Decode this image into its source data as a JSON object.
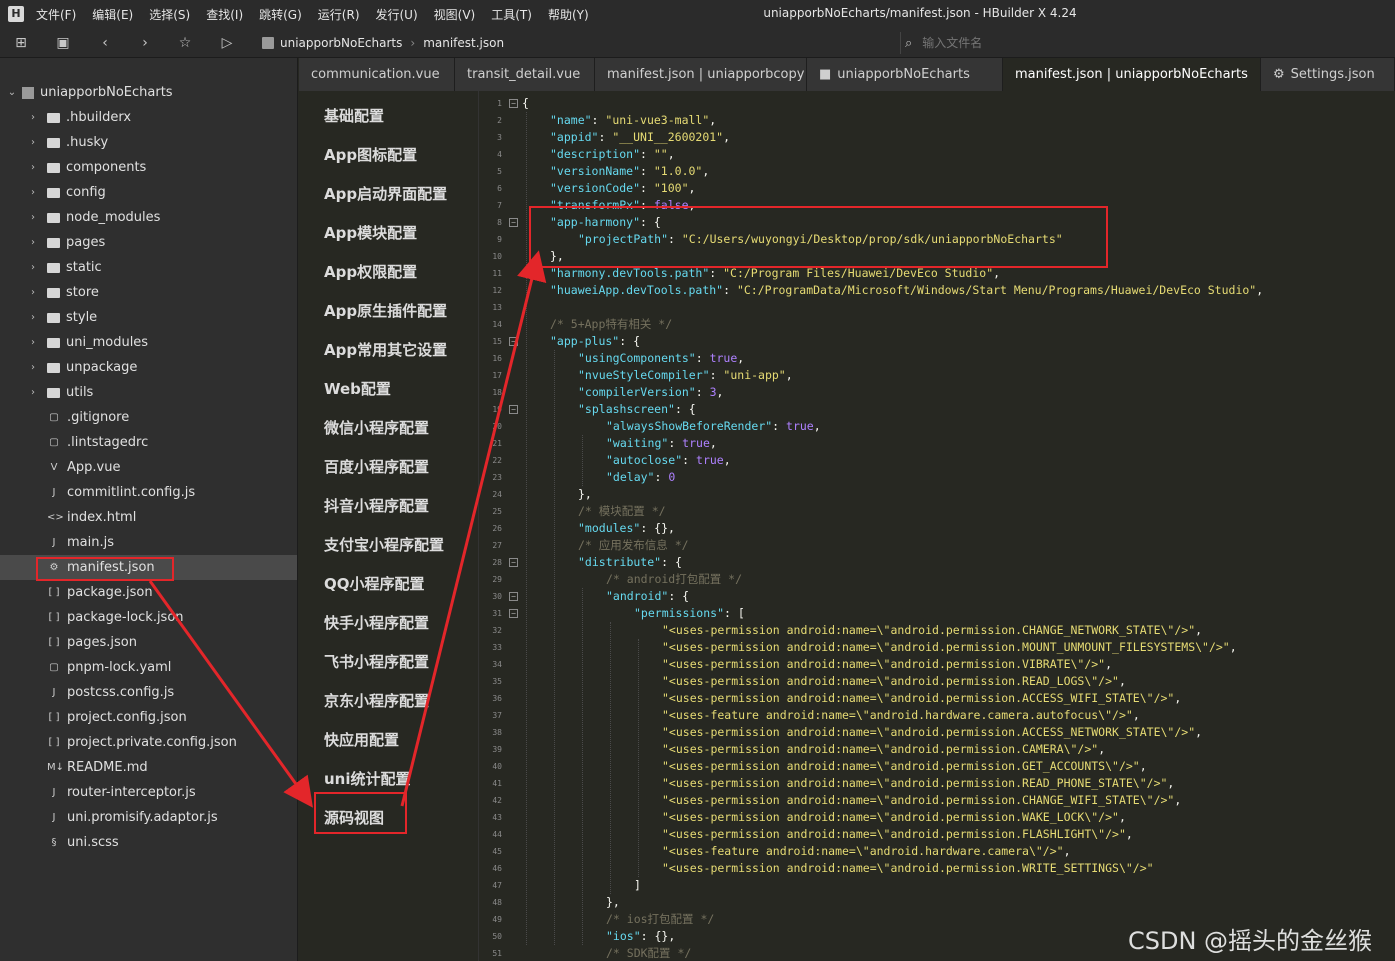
{
  "window": {
    "title": "uniapporbNoEcharts/manifest.json - HBuilder X 4.24"
  },
  "menu": [
    "文件(F)",
    "编辑(E)",
    "选择(S)",
    "查找(I)",
    "跳转(G)",
    "运行(R)",
    "发行(U)",
    "视图(V)",
    "工具(T)",
    "帮助(Y)"
  ],
  "toolbar": {
    "breadcrumb": [
      "uniapporbNoEcharts",
      "manifest.json"
    ],
    "search_placeholder": "输入文件名"
  },
  "sidebar": {
    "root": "uniapporbNoEcharts",
    "items": [
      {
        "label": ".hbuilderx",
        "type": "folder"
      },
      {
        "label": ".husky",
        "type": "folder"
      },
      {
        "label": "components",
        "type": "folder"
      },
      {
        "label": "config",
        "type": "folder"
      },
      {
        "label": "node_modules",
        "type": "folder"
      },
      {
        "label": "pages",
        "type": "folder"
      },
      {
        "label": "static",
        "type": "folder"
      },
      {
        "label": "store",
        "type": "folder"
      },
      {
        "label": "style",
        "type": "folder"
      },
      {
        "label": "uni_modules",
        "type": "folder"
      },
      {
        "label": "unpackage",
        "type": "folder"
      },
      {
        "label": "utils",
        "type": "folder"
      },
      {
        "label": ".gitignore",
        "type": "file"
      },
      {
        "label": ".lintstagedrc",
        "type": "file"
      },
      {
        "label": "App.vue",
        "type": "vue"
      },
      {
        "label": "commitlint.config.js",
        "type": "js"
      },
      {
        "label": "index.html",
        "type": "html"
      },
      {
        "label": "main.js",
        "type": "js"
      },
      {
        "label": "manifest.json",
        "type": "manifest",
        "selected": true
      },
      {
        "label": "package.json",
        "type": "json"
      },
      {
        "label": "package-lock.json",
        "type": "json"
      },
      {
        "label": "pages.json",
        "type": "json"
      },
      {
        "label": "pnpm-lock.yaml",
        "type": "file"
      },
      {
        "label": "postcss.config.js",
        "type": "js"
      },
      {
        "label": "project.config.json",
        "type": "json"
      },
      {
        "label": "project.private.config.json",
        "type": "json"
      },
      {
        "label": "README.md",
        "type": "md"
      },
      {
        "label": "router-interceptor.js",
        "type": "js"
      },
      {
        "label": "uni.promisify.adaptor.js",
        "type": "js"
      },
      {
        "label": "uni.scss",
        "type": "scss"
      }
    ]
  },
  "tabs": [
    {
      "label": "communication.vue",
      "active": false
    },
    {
      "label": "transit_detail.vue",
      "active": false
    },
    {
      "label": "manifest.json | uniapporbcopy",
      "active": false
    },
    {
      "label": "uniapporbNoEcharts",
      "active": false,
      "icon": "folder"
    },
    {
      "label": "manifest.json | uniapporbNoEcharts",
      "active": true
    },
    {
      "label": "Settings.json",
      "active": false,
      "icon": "gear"
    }
  ],
  "config_nav": [
    "基础配置",
    "App图标配置",
    "App启动界面配置",
    "App模块配置",
    "App权限配置",
    "App原生插件配置",
    "App常用其它设置",
    "Web配置",
    "微信小程序配置",
    "百度小程序配置",
    "抖音小程序配置",
    "支付宝小程序配置",
    "QQ小程序配置",
    "快手小程序配置",
    "飞书小程序配置",
    "京东小程序配置",
    "快应用配置",
    "uni统计配置",
    "源码视图"
  ],
  "code": {
    "lines": [
      {
        "n": "1",
        "fold": true,
        "indent": 0,
        "parts": [
          [
            "p",
            "{"
          ]
        ]
      },
      {
        "n": "2",
        "indent": 1,
        "parts": [
          [
            "k",
            "\"name\""
          ],
          [
            "p",
            ": "
          ],
          [
            "s",
            "\"uni-vue3-mall\""
          ],
          [
            "p",
            ","
          ]
        ]
      },
      {
        "n": "3",
        "indent": 1,
        "parts": [
          [
            "k",
            "\"appid\""
          ],
          [
            "p",
            ": "
          ],
          [
            "s",
            "\"__UNI__2600201\""
          ],
          [
            "p",
            ","
          ]
        ]
      },
      {
        "n": "4",
        "indent": 1,
        "parts": [
          [
            "k",
            "\"description\""
          ],
          [
            "p",
            ": "
          ],
          [
            "s",
            "\"\""
          ],
          [
            "p",
            ","
          ]
        ]
      },
      {
        "n": "5",
        "indent": 1,
        "parts": [
          [
            "k",
            "\"versionName\""
          ],
          [
            "p",
            ": "
          ],
          [
            "s",
            "\"1.0.0\""
          ],
          [
            "p",
            ","
          ]
        ]
      },
      {
        "n": "6",
        "indent": 1,
        "parts": [
          [
            "k",
            "\"versionCode\""
          ],
          [
            "p",
            ": "
          ],
          [
            "s",
            "\"100\""
          ],
          [
            "p",
            ","
          ]
        ]
      },
      {
        "n": "7",
        "indent": 1,
        "parts": [
          [
            "k",
            "\"transformPx\""
          ],
          [
            "p",
            ": "
          ],
          [
            "n",
            "false"
          ],
          [
            "p",
            ","
          ]
        ]
      },
      {
        "n": "8",
        "fold": true,
        "indent": 1,
        "parts": [
          [
            "k",
            "\"app-harmony\""
          ],
          [
            "p",
            ": {"
          ]
        ]
      },
      {
        "n": "9",
        "indent": 2,
        "parts": [
          [
            "k",
            "\"projectPath\""
          ],
          [
            "p",
            ": "
          ],
          [
            "s",
            "\"C:/Users/wuyongyi/Desktop/prop/sdk/uniapporbNoEcharts\""
          ]
        ]
      },
      {
        "n": "10",
        "indent": 1,
        "parts": [
          [
            "p",
            "},"
          ]
        ]
      },
      {
        "n": "11",
        "indent": 1,
        "parts": [
          [
            "k",
            "\"harmony.devTools.path\""
          ],
          [
            "p",
            ": "
          ],
          [
            "s",
            "\"C:/Program Files/Huawei/DevEco Studio\""
          ],
          [
            "p",
            ","
          ]
        ]
      },
      {
        "n": "12",
        "indent": 1,
        "parts": [
          [
            "k",
            "\"huaweiApp.devTools.path\""
          ],
          [
            "p",
            ": "
          ],
          [
            "s",
            "\"C:/ProgramData/Microsoft/Windows/Start Menu/Programs/Huawei/DevEco Studio\""
          ],
          [
            "p",
            ","
          ]
        ]
      },
      {
        "n": "13",
        "indent": 0,
        "parts": []
      },
      {
        "n": "14",
        "indent": 1,
        "parts": [
          [
            "c",
            "/* 5+App特有相关 */"
          ]
        ]
      },
      {
        "n": "15",
        "fold": true,
        "indent": 1,
        "parts": [
          [
            "k",
            "\"app-plus\""
          ],
          [
            "p",
            ": {"
          ]
        ]
      },
      {
        "n": "16",
        "indent": 2,
        "parts": [
          [
            "k",
            "\"usingComponents\""
          ],
          [
            "p",
            ": "
          ],
          [
            "n",
            "true"
          ],
          [
            "p",
            ","
          ]
        ]
      },
      {
        "n": "17",
        "indent": 2,
        "parts": [
          [
            "k",
            "\"nvueStyleCompiler\""
          ],
          [
            "p",
            ": "
          ],
          [
            "s",
            "\"uni-app\""
          ],
          [
            "p",
            ","
          ]
        ]
      },
      {
        "n": "18",
        "indent": 2,
        "parts": [
          [
            "k",
            "\"compilerVersion\""
          ],
          [
            "p",
            ": "
          ],
          [
            "n",
            "3"
          ],
          [
            "p",
            ","
          ]
        ]
      },
      {
        "n": "19",
        "fold": true,
        "indent": 2,
        "parts": [
          [
            "k",
            "\"splashscreen\""
          ],
          [
            "p",
            ": {"
          ]
        ]
      },
      {
        "n": "20",
        "indent": 3,
        "parts": [
          [
            "k",
            "\"alwaysShowBeforeRender\""
          ],
          [
            "p",
            ": "
          ],
          [
            "n",
            "true"
          ],
          [
            "p",
            ","
          ]
        ]
      },
      {
        "n": "21",
        "indent": 3,
        "parts": [
          [
            "k",
            "\"waiting\""
          ],
          [
            "p",
            ": "
          ],
          [
            "n",
            "true"
          ],
          [
            "p",
            ","
          ]
        ]
      },
      {
        "n": "22",
        "indent": 3,
        "parts": [
          [
            "k",
            "\"autoclose\""
          ],
          [
            "p",
            ": "
          ],
          [
            "n",
            "true"
          ],
          [
            "p",
            ","
          ]
        ]
      },
      {
        "n": "23",
        "indent": 3,
        "parts": [
          [
            "k",
            "\"delay\""
          ],
          [
            "p",
            ": "
          ],
          [
            "n",
            "0"
          ]
        ]
      },
      {
        "n": "24",
        "indent": 2,
        "parts": [
          [
            "p",
            "},"
          ]
        ]
      },
      {
        "n": "25",
        "indent": 2,
        "parts": [
          [
            "c",
            "/* 模块配置 */"
          ]
        ]
      },
      {
        "n": "26",
        "indent": 2,
        "parts": [
          [
            "k",
            "\"modules\""
          ],
          [
            "p",
            ": {},"
          ]
        ]
      },
      {
        "n": "27",
        "indent": 2,
        "parts": [
          [
            "c",
            "/* 应用发布信息 */"
          ]
        ]
      },
      {
        "n": "28",
        "fold": true,
        "indent": 2,
        "parts": [
          [
            "k",
            "\"distribute\""
          ],
          [
            "p",
            ": {"
          ]
        ]
      },
      {
        "n": "29",
        "indent": 3,
        "parts": [
          [
            "c",
            "/* android打包配置 */"
          ]
        ]
      },
      {
        "n": "30",
        "fold": true,
        "indent": 3,
        "parts": [
          [
            "k",
            "\"android\""
          ],
          [
            "p",
            ": {"
          ]
        ]
      },
      {
        "n": "31",
        "fold": true,
        "indent": 4,
        "parts": [
          [
            "k",
            "\"permissions\""
          ],
          [
            "p",
            ": ["
          ]
        ]
      },
      {
        "n": "32",
        "indent": 5,
        "parts": [
          [
            "s",
            "\"<uses-permission android:name=\\\"android.permission.CHANGE_NETWORK_STATE\\\"/>\""
          ],
          [
            "p",
            ","
          ]
        ]
      },
      {
        "n": "33",
        "indent": 5,
        "parts": [
          [
            "s",
            "\"<uses-permission android:name=\\\"android.permission.MOUNT_UNMOUNT_FILESYSTEMS\\\"/>\""
          ],
          [
            "p",
            ","
          ]
        ]
      },
      {
        "n": "34",
        "indent": 5,
        "parts": [
          [
            "s",
            "\"<uses-permission android:name=\\\"android.permission.VIBRATE\\\"/>\""
          ],
          [
            "p",
            ","
          ]
        ]
      },
      {
        "n": "35",
        "indent": 5,
        "parts": [
          [
            "s",
            "\"<uses-permission android:name=\\\"android.permission.READ_LOGS\\\"/>\""
          ],
          [
            "p",
            ","
          ]
        ]
      },
      {
        "n": "36",
        "indent": 5,
        "parts": [
          [
            "s",
            "\"<uses-permission android:name=\\\"android.permission.ACCESS_WIFI_STATE\\\"/>\""
          ],
          [
            "p",
            ","
          ]
        ]
      },
      {
        "n": "37",
        "indent": 5,
        "parts": [
          [
            "s",
            "\"<uses-feature android:name=\\\"android.hardware.camera.autofocus\\\"/>\""
          ],
          [
            "p",
            ","
          ]
        ]
      },
      {
        "n": "38",
        "indent": 5,
        "parts": [
          [
            "s",
            "\"<uses-permission android:name=\\\"android.permission.ACCESS_NETWORK_STATE\\\"/>\""
          ],
          [
            "p",
            ","
          ]
        ]
      },
      {
        "n": "39",
        "indent": 5,
        "parts": [
          [
            "s",
            "\"<uses-permission android:name=\\\"android.permission.CAMERA\\\"/>\""
          ],
          [
            "p",
            ","
          ]
        ]
      },
      {
        "n": "40",
        "indent": 5,
        "parts": [
          [
            "s",
            "\"<uses-permission android:name=\\\"android.permission.GET_ACCOUNTS\\\"/>\""
          ],
          [
            "p",
            ","
          ]
        ]
      },
      {
        "n": "41",
        "indent": 5,
        "parts": [
          [
            "s",
            "\"<uses-permission android:name=\\\"android.permission.READ_PHONE_STATE\\\"/>\""
          ],
          [
            "p",
            ","
          ]
        ]
      },
      {
        "n": "42",
        "indent": 5,
        "parts": [
          [
            "s",
            "\"<uses-permission android:name=\\\"android.permission.CHANGE_WIFI_STATE\\\"/>\""
          ],
          [
            "p",
            ","
          ]
        ]
      },
      {
        "n": "43",
        "indent": 5,
        "parts": [
          [
            "s",
            "\"<uses-permission android:name=\\\"android.permission.WAKE_LOCK\\\"/>\""
          ],
          [
            "p",
            ","
          ]
        ]
      },
      {
        "n": "44",
        "indent": 5,
        "parts": [
          [
            "s",
            "\"<uses-permission android:name=\\\"android.permission.FLASHLIGHT\\\"/>\""
          ],
          [
            "p",
            ","
          ]
        ]
      },
      {
        "n": "45",
        "indent": 5,
        "parts": [
          [
            "s",
            "\"<uses-feature android:name=\\\"android.hardware.camera\\\"/>\""
          ],
          [
            "p",
            ","
          ]
        ]
      },
      {
        "n": "46",
        "indent": 5,
        "parts": [
          [
            "s",
            "\"<uses-permission android:name=\\\"android.permission.WRITE_SETTINGS\\\"/>\""
          ]
        ]
      },
      {
        "n": "47",
        "indent": 4,
        "parts": [
          [
            "p",
            "]"
          ]
        ]
      },
      {
        "n": "48",
        "indent": 3,
        "parts": [
          [
            "p",
            "},"
          ]
        ]
      },
      {
        "n": "49",
        "indent": 3,
        "parts": [
          [
            "c",
            "/* ios打包配置 */"
          ]
        ]
      },
      {
        "n": "50",
        "indent": 3,
        "parts": [
          [
            "k",
            "\"ios\""
          ],
          [
            "p",
            ": {},"
          ]
        ]
      },
      {
        "n": "51",
        "indent": 3,
        "parts": [
          [
            "c",
            "/* SDK配置 */"
          ]
        ]
      }
    ]
  },
  "watermark": "CSDN @摇头的金丝猴",
  "colors": {
    "annotation": "#e3262a"
  }
}
